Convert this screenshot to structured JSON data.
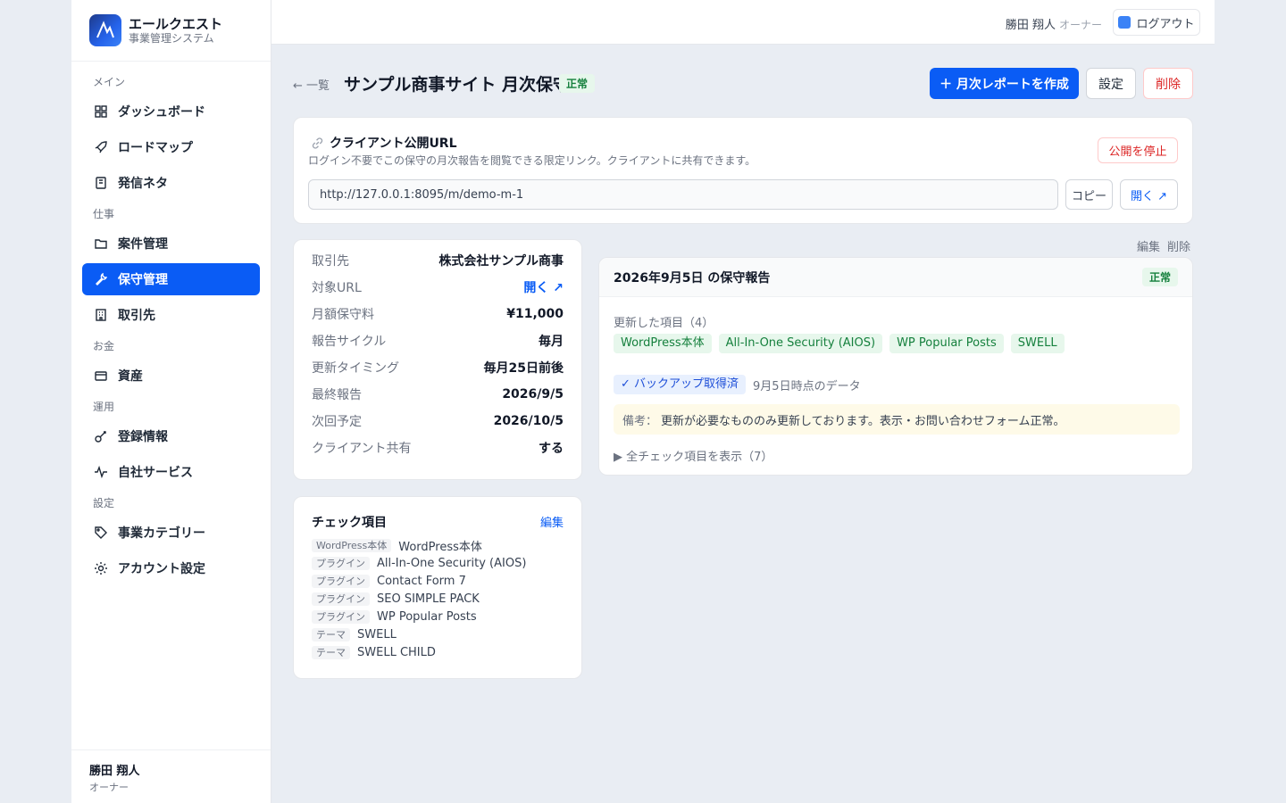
{
  "brand": {
    "name": "エールクエスト",
    "sub": "事業管理システム"
  },
  "sidebar": {
    "sections": [
      {
        "label": "メイン",
        "items": [
          {
            "label": "ダッシュボード",
            "icon": "grid-icon"
          },
          {
            "label": "ロードマップ",
            "icon": "rocket-icon"
          },
          {
            "label": "発信ネタ",
            "icon": "notebook-icon"
          }
        ]
      },
      {
        "label": "仕事",
        "items": [
          {
            "label": "案件管理",
            "icon": "folder-icon"
          },
          {
            "label": "保守管理",
            "icon": "wrench-icon",
            "active": true
          },
          {
            "label": "取引先",
            "icon": "building-icon"
          }
        ]
      },
      {
        "label": "お金",
        "items": [
          {
            "label": "資産",
            "icon": "card-icon"
          }
        ]
      },
      {
        "label": "運用",
        "items": [
          {
            "label": "登録情報",
            "icon": "key-icon"
          },
          {
            "label": "自社サービス",
            "icon": "pulse-icon"
          }
        ]
      },
      {
        "label": "設定",
        "items": [
          {
            "label": "事業カテゴリー",
            "icon": "tag-icon"
          },
          {
            "label": "アカウント設定",
            "icon": "gear-icon"
          }
        ]
      }
    ],
    "footer": {
      "name": "勝田 翔人",
      "role": "オーナー"
    }
  },
  "topbar": {
    "user": "勝田 翔人",
    "role": "オーナー",
    "logout": "ログアウト"
  },
  "header": {
    "back": "← 一覧",
    "title": "サンプル商事サイト 月次保守",
    "status": "正常",
    "create_report": "＋ 月次レポートを作成",
    "settings": "設定",
    "delete": "削除"
  },
  "public_url": {
    "title": "クライアント公開URL",
    "desc": "ログイン不要でこの保守の月次報告を閲覧できる限定リンク。クライアントに共有できます。",
    "stop": "公開を停止",
    "url": "http://127.0.0.1:8095/m/demo-m-1",
    "copy": "コピー",
    "open": "開く ↗"
  },
  "info": [
    {
      "k": "取引先",
      "v": "株式会社サンプル商事"
    },
    {
      "k": "対象URL",
      "v": "開く ↗",
      "link": true
    },
    {
      "k": "月額保守料",
      "v": "¥11,000"
    },
    {
      "k": "報告サイクル",
      "v": "毎月"
    },
    {
      "k": "更新タイミング",
      "v": "毎月25日前後"
    },
    {
      "k": "最終報告",
      "v": "2026/9/5"
    },
    {
      "k": "次回予定",
      "v": "2026/10/5"
    },
    {
      "k": "クライアント共有",
      "v": "する"
    }
  ],
  "checks": {
    "title": "チェック項目",
    "edit": "編集",
    "items": [
      {
        "tag": "WordPress本体",
        "name": "WordPress本体"
      },
      {
        "tag": "プラグイン",
        "name": "All-In-One Security (AIOS)"
      },
      {
        "tag": "プラグイン",
        "name": "Contact Form 7"
      },
      {
        "tag": "プラグイン",
        "name": "SEO SIMPLE PACK"
      },
      {
        "tag": "プラグイン",
        "name": "WP Popular Posts"
      },
      {
        "tag": "テーマ",
        "name": "SWELL"
      },
      {
        "tag": "テーマ",
        "name": "SWELL CHILD"
      }
    ]
  },
  "report": {
    "edit": "編集",
    "delete": "削除",
    "title": "2026年9月5日 の保守報告",
    "status": "正常",
    "updated_label": "更新した項目（4）",
    "updated": [
      "WordPress本体",
      "All-In-One Security (AIOS)",
      "WP Popular Posts",
      "SWELL"
    ],
    "backup": "✓ バックアップ取得済",
    "backup_date": "9月5日時点のデータ",
    "note_label": "備考：",
    "note": "更新が必要なもののみ更新しております。表示・お問い合わせフォーム正常。",
    "toggle": "▶ 全チェック項目を表示（7）"
  }
}
